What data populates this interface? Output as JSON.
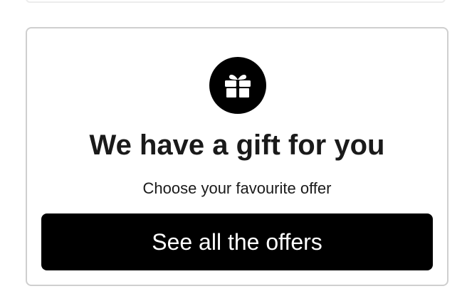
{
  "gift_card": {
    "icon": "gift-icon",
    "title": "We have a gift for you",
    "subtitle": "Choose your favourite offer",
    "cta_label": "See all the offers"
  },
  "colors": {
    "button_bg": "#000000",
    "button_text": "#ffffff",
    "card_border": "#cfcfcf",
    "text": "#1a1a1a"
  }
}
